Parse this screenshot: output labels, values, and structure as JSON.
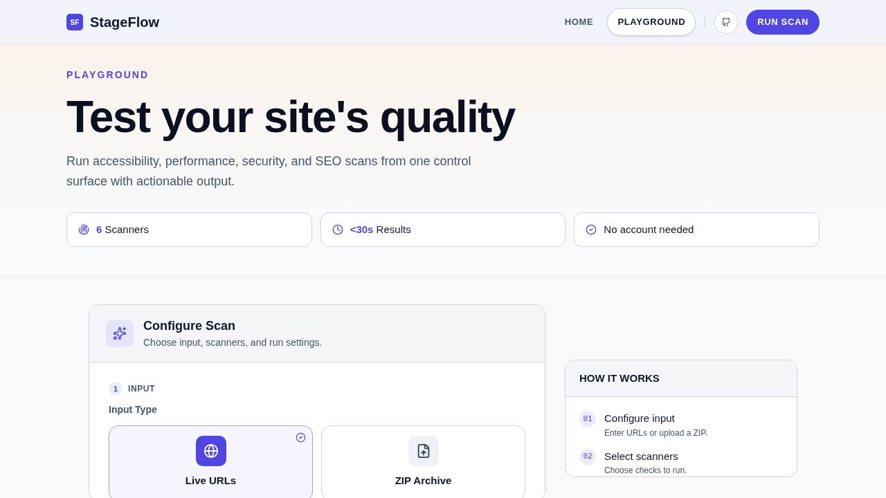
{
  "header": {
    "logo_mark": "SF",
    "brand": "StageFlow",
    "nav": [
      {
        "label": "HOME",
        "selected": false
      },
      {
        "label": "PLAYGROUND",
        "selected": true
      }
    ],
    "cta": "RUN SCAN"
  },
  "hero": {
    "eyebrow": "PLAYGROUND",
    "title": "Test your site's quality",
    "subtitle": "Run accessibility, performance, security, and SEO scans from one control surface with actionable output.",
    "stats": [
      {
        "kind": "radar",
        "text": "**6** Scanners"
      },
      {
        "kind": "clock",
        "text": "**<30s** Results"
      },
      {
        "kind": "check",
        "text": "No account needed"
      }
    ]
  },
  "configure": {
    "title": "Configure Scan",
    "subtitle": "Choose input, scanners, and run settings.",
    "step_number": "1",
    "step_label": "INPUT",
    "field_label": "Input Type",
    "input_types": [
      {
        "kind": "globe",
        "label": "Live URLs",
        "selected": true
      },
      {
        "kind": "file",
        "label": "ZIP Archive",
        "selected": false
      }
    ]
  },
  "how_it_works": {
    "title": "HOW IT WORKS",
    "steps": [
      {
        "number": "01",
        "title": "Configure input",
        "description": "Enter URLs or upload a ZIP."
      },
      {
        "number": "02",
        "title": "Select scanners",
        "description": "Choose checks to run."
      }
    ]
  }
}
